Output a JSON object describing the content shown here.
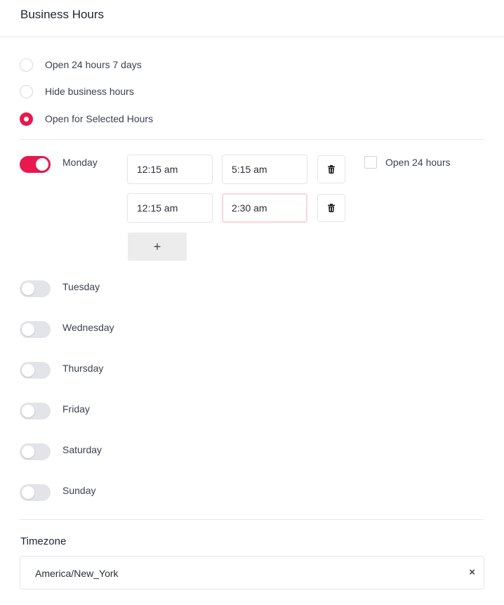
{
  "header": {
    "title": "Business Hours"
  },
  "mode_options": [
    {
      "label": "Open 24 hours 7 days",
      "selected": false
    },
    {
      "label": "Hide business hours",
      "selected": false
    },
    {
      "label": "Open for Selected Hours",
      "selected": true
    }
  ],
  "days": {
    "monday": {
      "label": "Monday",
      "enabled": true
    },
    "tuesday": {
      "label": "Tuesday",
      "enabled": false
    },
    "wednesday": {
      "label": "Wednesday",
      "enabled": false
    },
    "thursday": {
      "label": "Thursday",
      "enabled": false
    },
    "friday": {
      "label": "Friday",
      "enabled": false
    },
    "saturday": {
      "label": "Saturday",
      "enabled": false
    },
    "sunday": {
      "label": "Sunday",
      "enabled": false
    }
  },
  "monday_slots": [
    {
      "open": "12:15 am",
      "close": "5:15 am"
    },
    {
      "open": "12:15 am",
      "close": "2:30 am"
    }
  ],
  "open24": {
    "label": "Open 24 hours",
    "checked": false
  },
  "add_button": {
    "symbol": "+"
  },
  "timezone": {
    "label": "Timezone",
    "value": "America/New_York",
    "clear_symbol": "×"
  },
  "colors": {
    "accent": "#e8194f",
    "toggle_off": "#e2e4ea",
    "border": "#e3e5ea"
  },
  "icons": {
    "trash": "trash-icon",
    "add": "plus-icon",
    "clear": "close-icon"
  }
}
